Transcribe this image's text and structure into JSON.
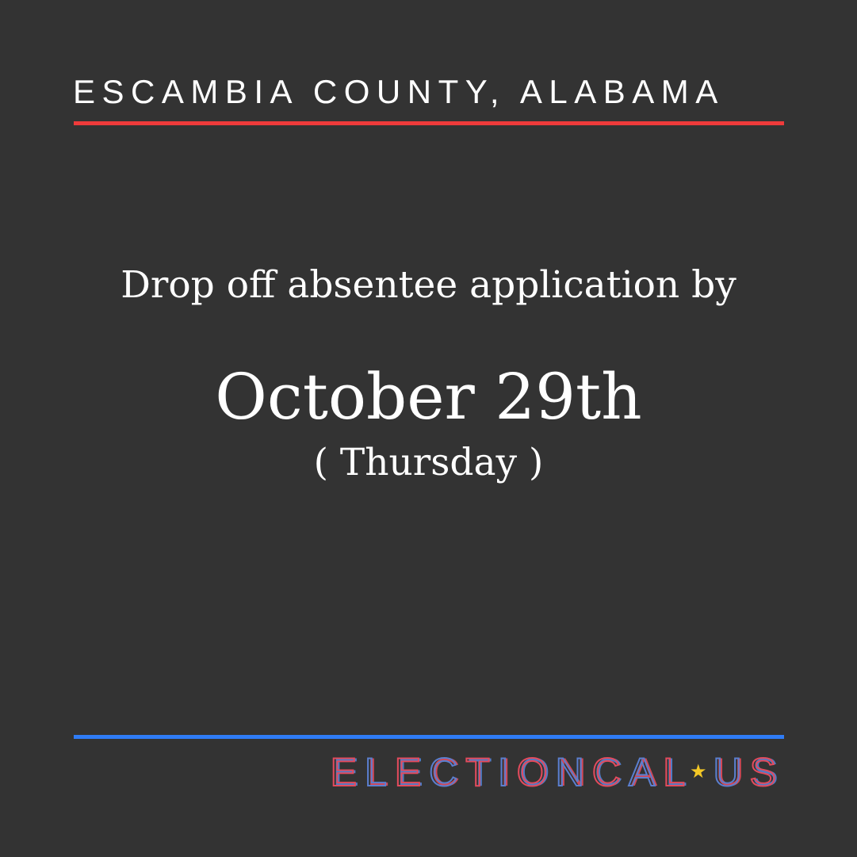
{
  "header": {
    "county_title": "ESCAMBIA COUNTY, ALABAMA"
  },
  "main": {
    "headline": "Drop off absentee application by",
    "date": "October 29th",
    "day": "( Thursday )"
  },
  "brand": {
    "text_main": "ELECTIONCAL",
    "separator_icon": "star-icon",
    "text_suffix": "US"
  },
  "colors": {
    "background": "#333333",
    "top_rule": "#ef3b3b",
    "bottom_rule": "#2f7cf6",
    "text": "#ffffff",
    "brand_red": "#e44b5d",
    "brand_blue": "#5b7fd0",
    "brand_star": "#f3c826"
  }
}
